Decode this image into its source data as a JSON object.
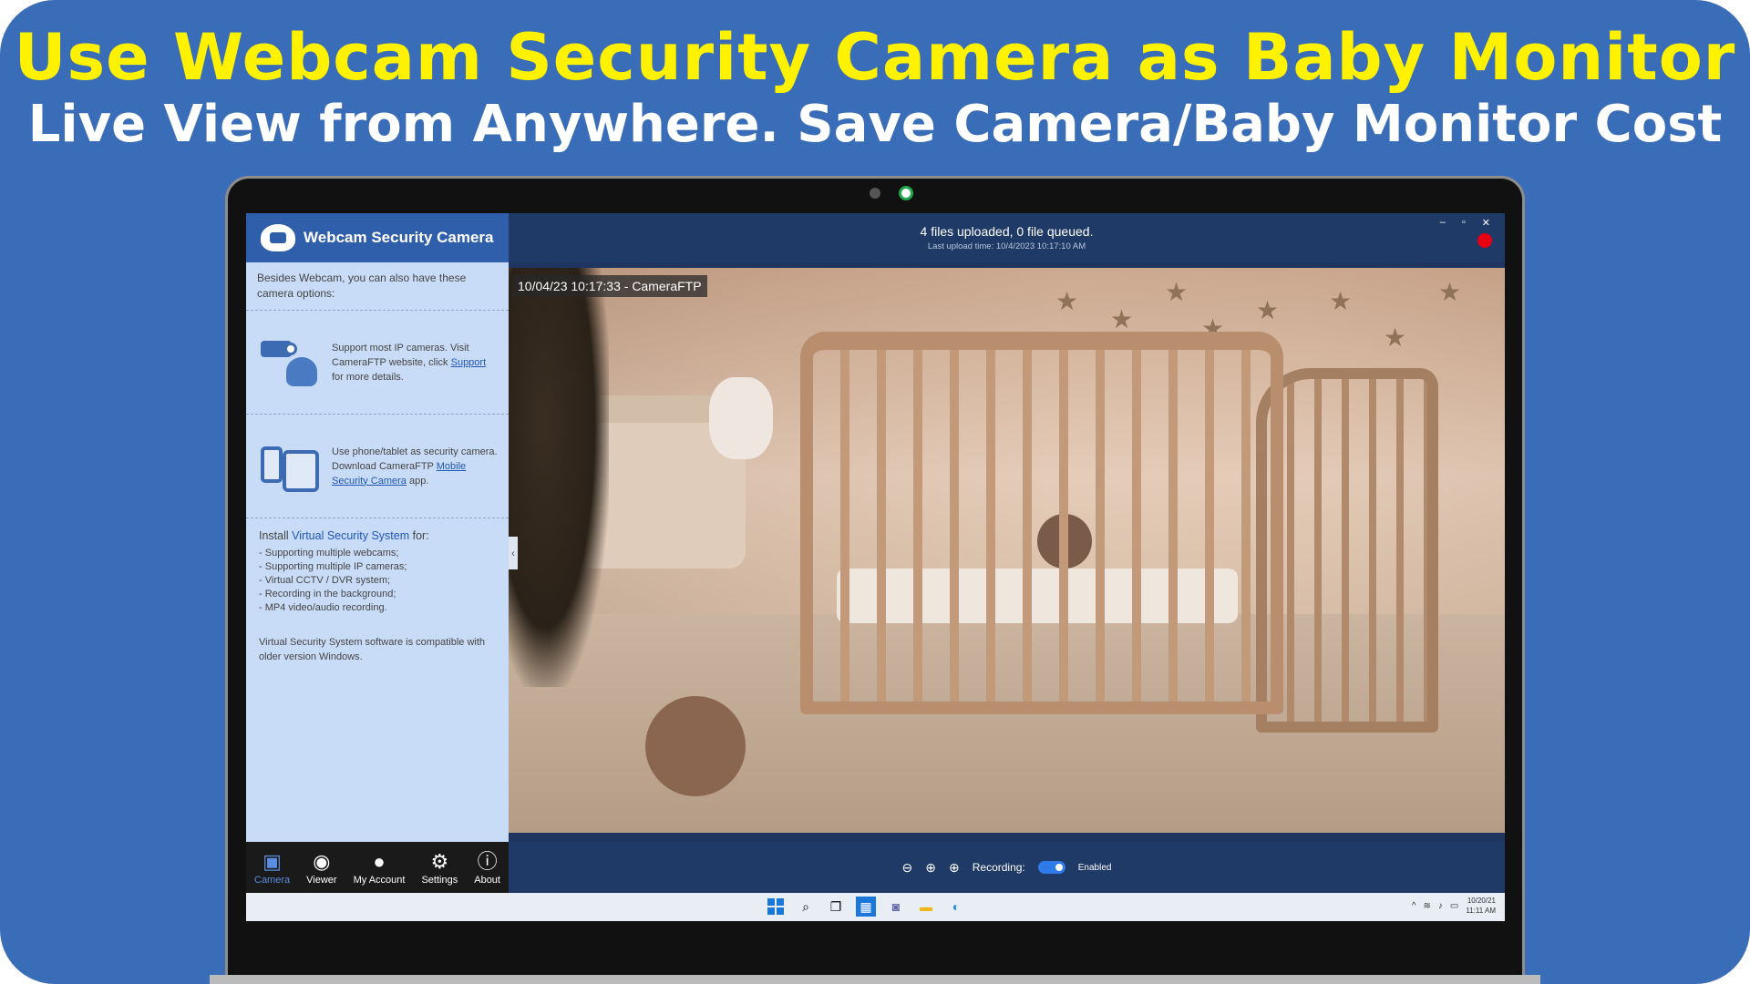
{
  "banner": {
    "headline": "Use Webcam Security Camera as Baby Monitor",
    "subline": "Live View from Anywhere. Save Camera/Baby Monitor Cost"
  },
  "app": {
    "title": "Webcam Security Camera",
    "intro": "Besides Webcam, you can also have these camera options:",
    "option_ip": {
      "text_before": "Support most IP cameras. Visit CameraFTP website, click ",
      "link": "Support",
      "text_after": " for more details."
    },
    "option_mobile": {
      "text_before": "Use phone/tablet as security camera. Download CameraFTP ",
      "link": "Mobile Security Camera",
      "text_after": " app."
    },
    "install": {
      "prefix": "Install",
      "link": "Virtual Security System",
      "suffix": "for:",
      "items": [
        "Supporting multiple webcams;",
        "Supporting multiple IP cameras;",
        "Virtual CCTV / DVR system;",
        "Recording in the background;",
        "MP4 video/audio recording."
      ],
      "note": "Virtual Security System software is compatible with older version Windows."
    },
    "nav": [
      {
        "label": "Camera",
        "icon": "camera-ftp-icon",
        "active": true
      },
      {
        "label": "Viewer",
        "icon": "eye-icon",
        "active": false
      },
      {
        "label": "My Account",
        "icon": "user-icon",
        "active": false
      },
      {
        "label": "Settings",
        "icon": "gear-icon",
        "active": false
      },
      {
        "label": "About",
        "icon": "info-icon",
        "active": false
      }
    ],
    "upload_status": "4 files uploaded, 0 file queued.",
    "upload_time": "Last upload time: 10/4/2023 10:17:10 AM",
    "timestamp_overlay": "10/04/23 10:17:33 - CameraFTP",
    "recording_label": "Recording:",
    "recording_state": "Enabled",
    "record_indicator_color": "#e60012"
  },
  "taskbar": {
    "date": "10/20/21",
    "time": "11:11 AM"
  },
  "colors": {
    "banner_bg": "#3a6db7",
    "headline": "#fff200",
    "app_header": "#2f5eaa",
    "sidebar_bg": "#c9dcf7"
  }
}
